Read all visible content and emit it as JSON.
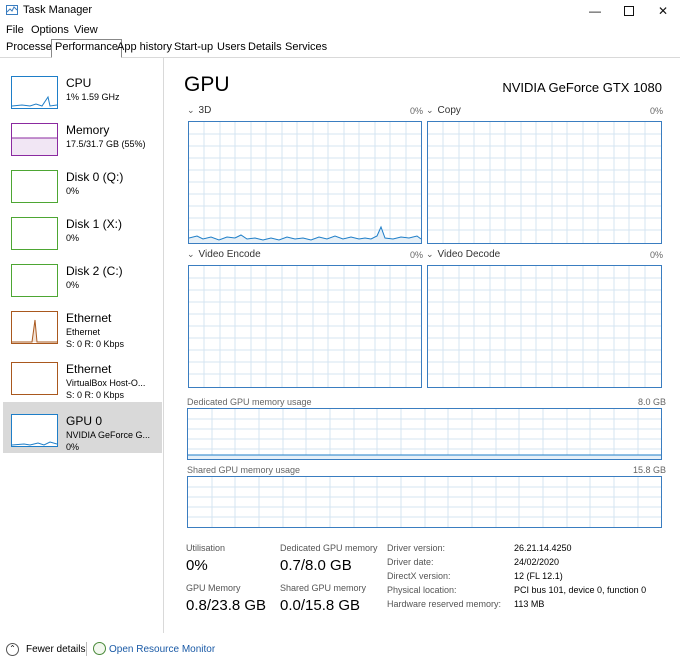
{
  "window": {
    "title": "Task Manager"
  },
  "menu": {
    "file": "File",
    "options": "Options",
    "view": "View"
  },
  "tabs": [
    {
      "label": "Processes"
    },
    {
      "label": "Performance"
    },
    {
      "label": "App history"
    },
    {
      "label": "Start-up"
    },
    {
      "label": "Users"
    },
    {
      "label": "Details"
    },
    {
      "label": "Services"
    }
  ],
  "sidebar": {
    "items": [
      {
        "name": "CPU",
        "line1": "1% 1.59 GHz",
        "line2": "",
        "color": "#1e7ec8"
      },
      {
        "name": "Memory",
        "line1": "17.5/31.7 GB (55%)",
        "line2": "",
        "color": "#8b2aa0"
      },
      {
        "name": "Disk 0 (Q:)",
        "line1": "0%",
        "line2": "",
        "color": "#4da633"
      },
      {
        "name": "Disk 1 (X:)",
        "line1": "0%",
        "line2": "",
        "color": "#4da633"
      },
      {
        "name": "Disk 2 (C:)",
        "line1": "0%",
        "line2": "",
        "color": "#4da633"
      },
      {
        "name": "Ethernet",
        "line1": "Ethernet",
        "line2": "S: 0 R: 0 Kbps",
        "color": "#a9581e"
      },
      {
        "name": "Ethernet",
        "line1": "VirtualBox Host-O...",
        "line2": "S: 0 R: 0 Kbps",
        "color": "#a9581e"
      },
      {
        "name": "GPU 0",
        "line1": "NVIDIA GeForce G...",
        "line2": "0%",
        "color": "#1e7ec8"
      }
    ]
  },
  "main": {
    "title": "GPU",
    "model": "NVIDIA GeForce GTX 1080",
    "graphs": [
      {
        "label": "3D",
        "pct": "0%"
      },
      {
        "label": "Copy",
        "pct": "0%"
      },
      {
        "label": "Video Encode",
        "pct": "0%"
      },
      {
        "label": "Video Decode",
        "pct": "0%"
      }
    ],
    "dedicated": {
      "label": "Dedicated GPU memory usage",
      "max": "8.0 GB"
    },
    "shared": {
      "label": "Shared GPU memory usage",
      "max": "15.8 GB"
    },
    "stats": {
      "utilisation_label": "Utilisation",
      "utilisation": "0%",
      "dedicated_label": "Dedicated GPU memory",
      "dedicated": "0.7/8.0 GB",
      "gpu_memory_label": "GPU Memory",
      "gpu_memory": "0.8/23.8 GB",
      "shared_label": "Shared GPU memory",
      "shared": "0.0/15.8 GB"
    },
    "details": [
      {
        "label": "Driver version:",
        "value": "26.21.14.4250"
      },
      {
        "label": "Driver date:",
        "value": "24/02/2020"
      },
      {
        "label": "DirectX version:",
        "value": "12 (FL 12.1)"
      },
      {
        "label": "Physical location:",
        "value": "PCI bus 101, device 0, function 0"
      },
      {
        "label": "Hardware reserved memory:",
        "value": "113 MB"
      }
    ]
  },
  "footer": {
    "fewer_details": "Fewer details",
    "open_monitor": "Open Resource Monitor"
  },
  "colors": {
    "graph_border": "#3a7dc0",
    "grid": "#d4e4f2",
    "accent": "#1e7ec8"
  }
}
